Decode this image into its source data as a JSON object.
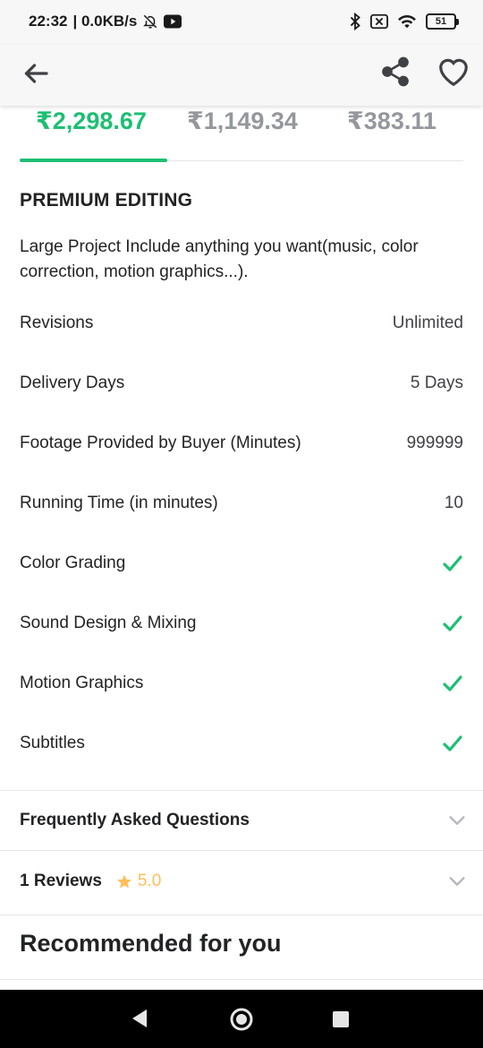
{
  "status_bar": {
    "time": "22:32",
    "network_speed": "| 0.0KB/s",
    "battery_level": "51",
    "icons": [
      "bell-off-icon",
      "youtube-icon",
      "bluetooth-icon",
      "sim-off-icon",
      "wifi-icon",
      "battery-icon"
    ]
  },
  "app_bar": {
    "icons": [
      "back-arrow-icon",
      "share-icon",
      "heart-icon"
    ]
  },
  "tabs": [
    {
      "label": "₹2,298.67",
      "active": true
    },
    {
      "label": "₹1,149.34",
      "active": false
    },
    {
      "label": "₹383.11",
      "active": false
    }
  ],
  "package": {
    "title": "PREMIUM EDITING",
    "description": "Large Project Include anything you want(music, color correction, motion graphics...).",
    "features": [
      {
        "label": "Revisions",
        "value": "Unlimited"
      },
      {
        "label": "Delivery Days",
        "value": "5 Days"
      },
      {
        "label": "Footage Provided by Buyer (Minutes)",
        "value": "999999"
      },
      {
        "label": "Running Time (in minutes)",
        "value": "10"
      },
      {
        "label": "Color Grading",
        "value": "check"
      },
      {
        "label": "Sound Design & Mixing",
        "value": "check"
      },
      {
        "label": "Motion Graphics",
        "value": "check"
      },
      {
        "label": "Subtitles",
        "value": "check"
      }
    ]
  },
  "faq": {
    "label": "Frequently Asked Questions"
  },
  "reviews": {
    "label": "1 Reviews",
    "rating": "5.0"
  },
  "recommended": {
    "title": "Recommended for you"
  },
  "colors": {
    "accent_green": "#1dbf73",
    "star_yellow": "#ffbe5b",
    "text_dark": "#222325",
    "text_muted": "#95979d"
  }
}
